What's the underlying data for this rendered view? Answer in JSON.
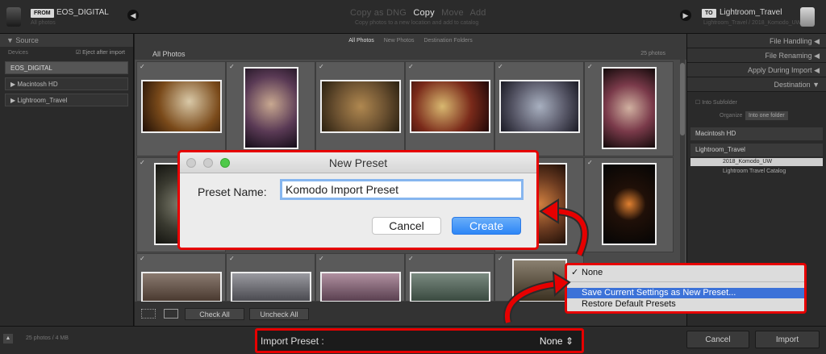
{
  "topbar": {
    "from_tag": "FROM",
    "source_name": "EOS_DIGITAL",
    "source_sub": "All photos",
    "modes": [
      "Copy as DNG",
      "Copy",
      "Move",
      "Add"
    ],
    "active_mode": "Copy",
    "modes_sub": "Copy photos to a new location and add to catalog",
    "to_tag": "TO",
    "dest_name": "Lightroom_Travel",
    "dest_sub": "Lightroom_Travel / 2018_Komodo_UW"
  },
  "left_panel": {
    "header": "Source",
    "devices_label": "Devices",
    "eject_label": "Eject after import",
    "items": [
      "EOS_DIGITAL",
      "Macintosh HD",
      "Lightroom_Travel"
    ]
  },
  "center": {
    "tabs": [
      "All Photos",
      "New Photos",
      "Destination Folders"
    ],
    "grid_title": "All Photos",
    "count": "25 photos",
    "check_all": "Check All",
    "uncheck_all": "Uncheck All",
    "check_mark": "✓"
  },
  "right_panel": {
    "sections": [
      "File Handling",
      "File Renaming",
      "Apply During Import",
      "Destination"
    ],
    "into_subfolder": "Into Subfolder",
    "organize_label": "Organize",
    "organize_value": "Into one folder",
    "macintosh": "Macintosh HD",
    "lightroom": "Lightroom_Travel",
    "folder": "2018_Komodo_UW",
    "catalog": "Lightroom Travel Catalog"
  },
  "bottom": {
    "info": "25 photos / 4 MB",
    "preset_label": "Import Preset :",
    "preset_value": "None",
    "cancel": "Cancel",
    "import": "Import"
  },
  "dialog": {
    "title": "New Preset",
    "name_label": "Preset Name:",
    "name_value": "Komodo Import Preset",
    "cancel": "Cancel",
    "create": "Create"
  },
  "preset_menu": {
    "items": [
      "None",
      "Save Current Settings as New Preset...",
      "Restore Default Presets"
    ],
    "checked": "✓"
  },
  "colors": {
    "highlight_red": "#e60000",
    "menu_select": "#3c72d8",
    "create_blue": "#2d86f6"
  }
}
